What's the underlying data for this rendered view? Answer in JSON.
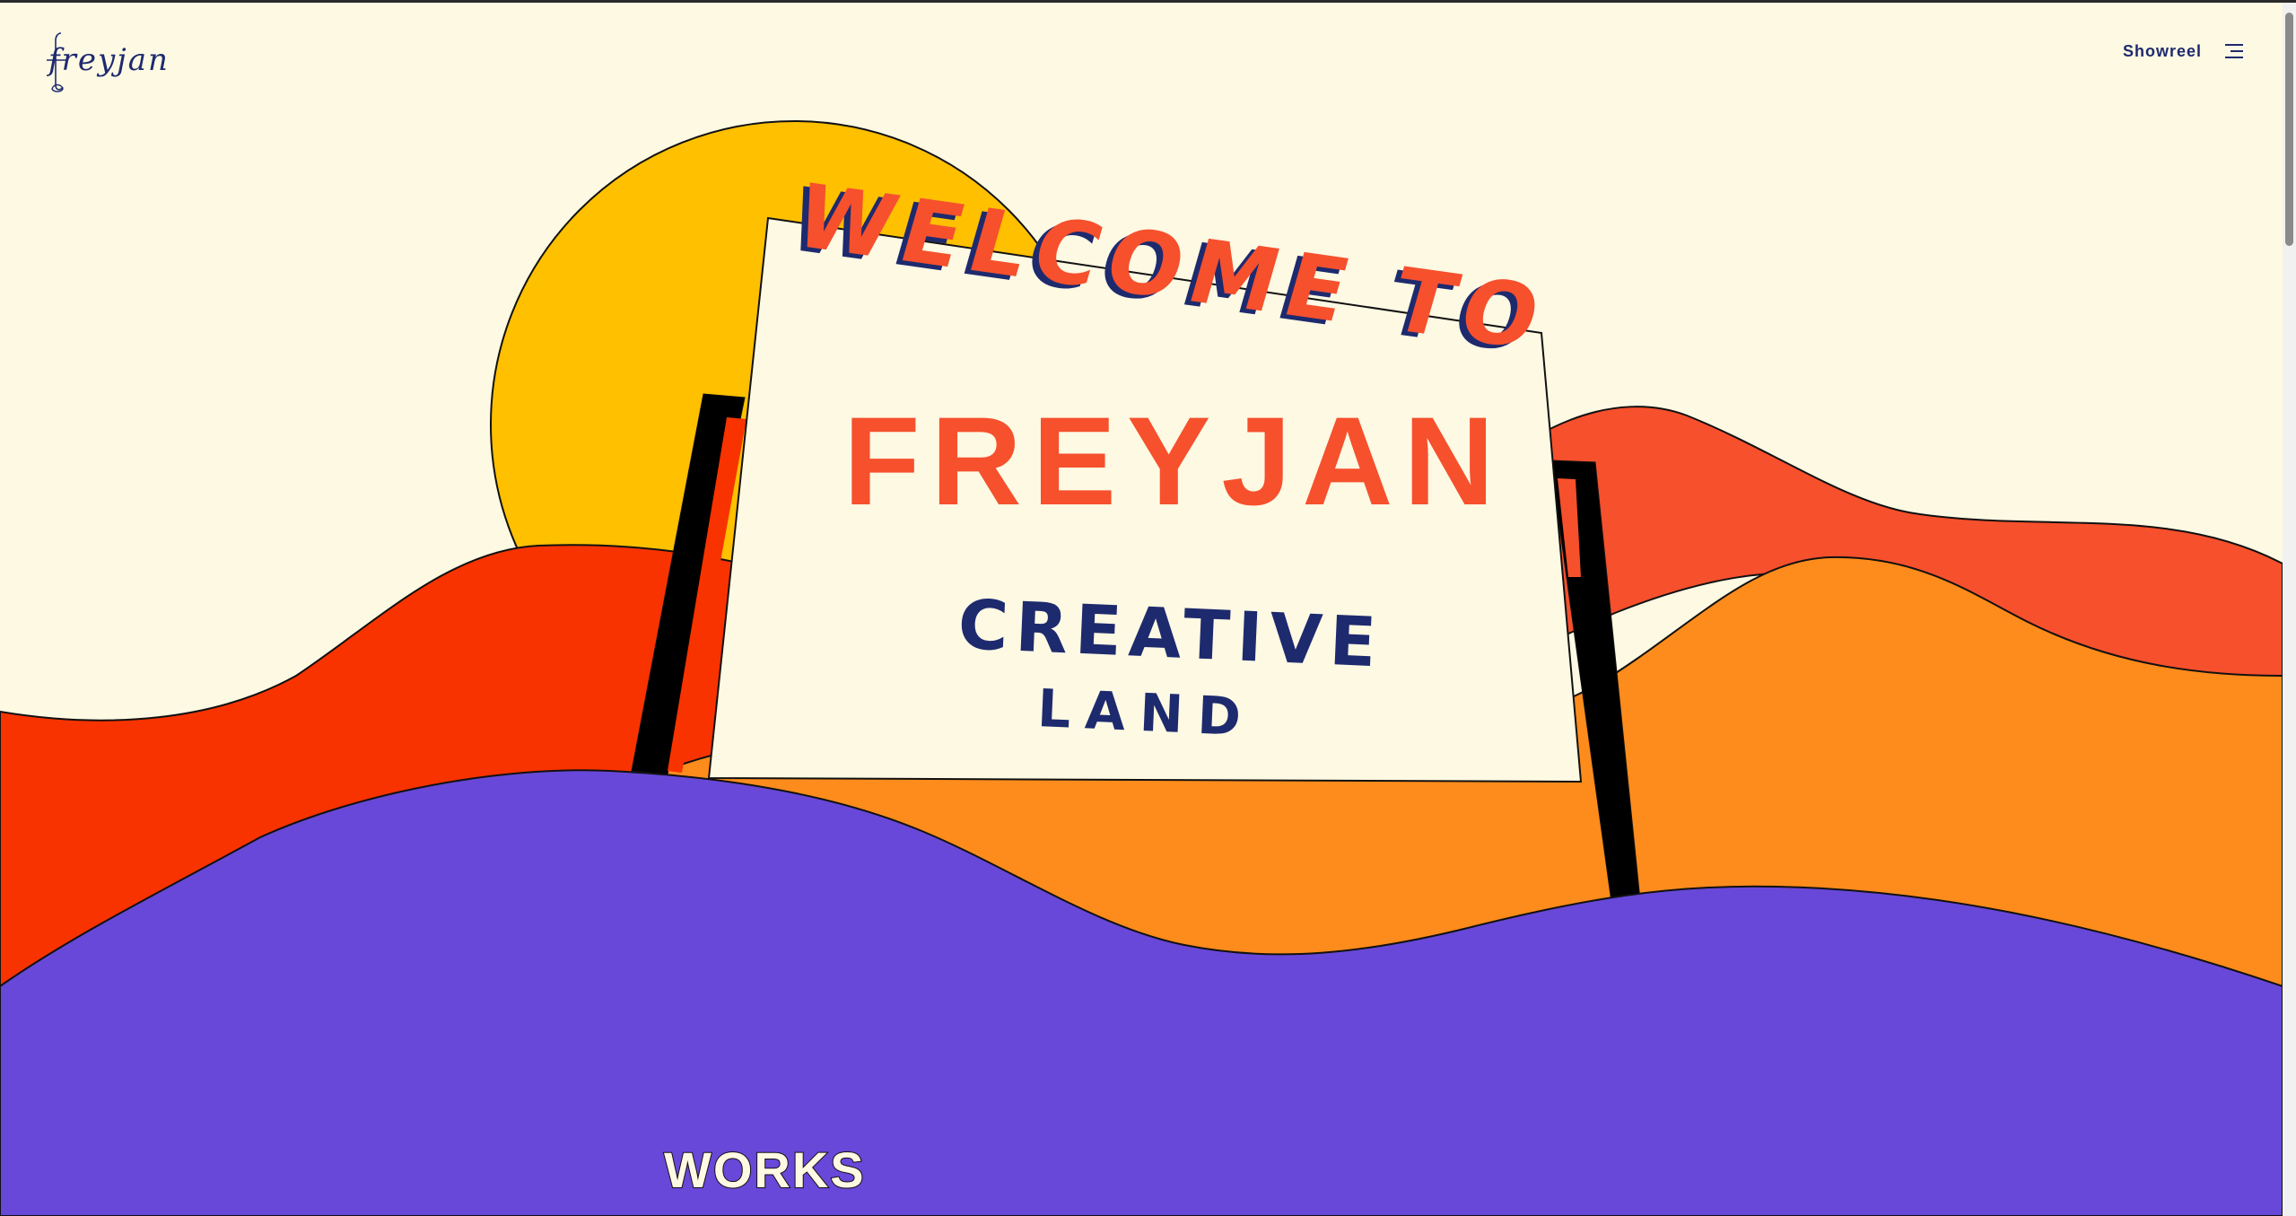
{
  "header": {
    "logo_text": "freyjan",
    "showreel_label": "Showreel",
    "menu_icon": "hamburger-menu-icon"
  },
  "hero": {
    "welcome_text": "WELCOME TO",
    "brand_text": "FREYJAN",
    "tagline_line1": "CREATIVE",
    "tagline_line2": "LAND"
  },
  "section": {
    "works_label": "WORKS"
  },
  "colors": {
    "background": "#fdf9e3",
    "sun": "#ffc000",
    "hill_red": "#f83300",
    "hill_coral": "#f6502d",
    "hill_orange": "#fe8c1c",
    "hill_purple": "#6748d8",
    "navy": "#1e2a6e",
    "sign_face": "#fdf9e3"
  }
}
